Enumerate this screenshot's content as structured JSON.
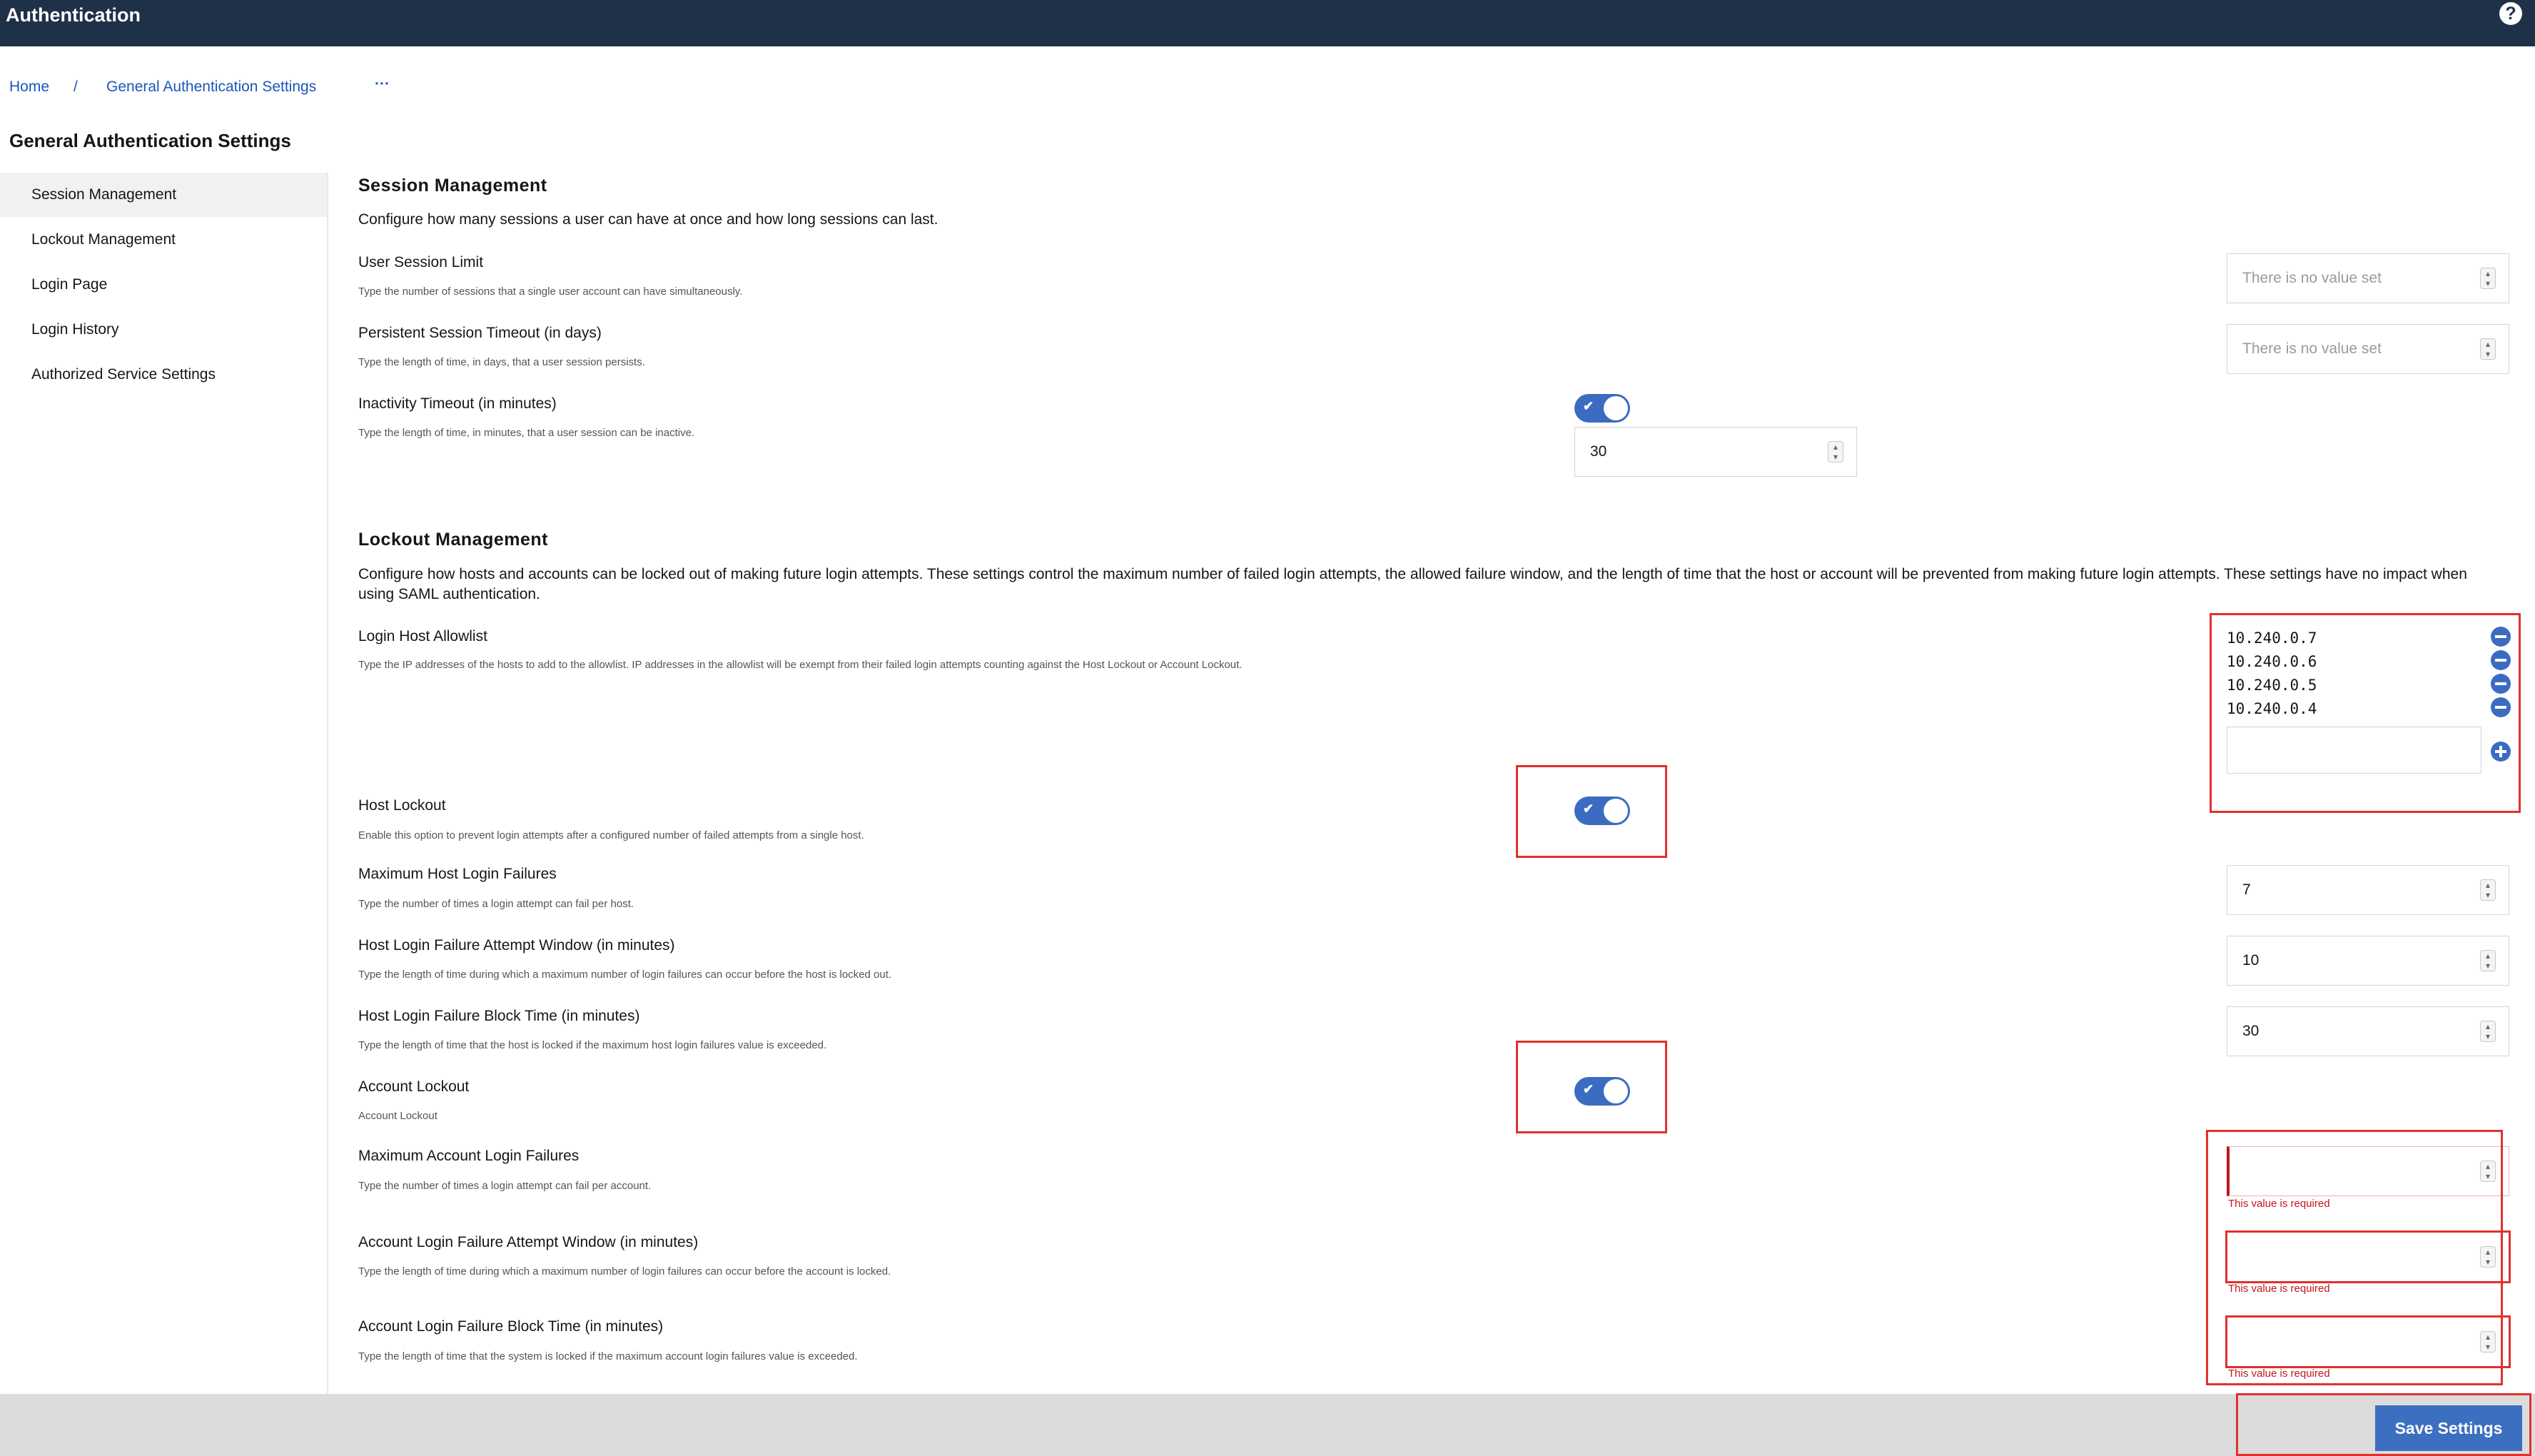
{
  "app": {
    "title": "Authentication",
    "help_icon": "?"
  },
  "breadcrumb": {
    "home": "Home",
    "separator": "/",
    "current": "General Authentication Settings",
    "more": "···"
  },
  "page_title": "General Authentication Settings",
  "sidebar": {
    "items": [
      {
        "label": "Session Management",
        "active": true
      },
      {
        "label": "Lockout Management"
      },
      {
        "label": "Login Page"
      },
      {
        "label": "Login History"
      },
      {
        "label": "Authorized Service Settings"
      }
    ]
  },
  "session": {
    "title": "Session Management",
    "description": "Configure how many sessions a user can have at once and how long sessions can last.",
    "user_session_limit": {
      "label": "User Session Limit",
      "help": "Type the number of sessions that a single user account can have simultaneously.",
      "placeholder": "There is no value set"
    },
    "persistent_timeout": {
      "label": "Persistent Session Timeout (in days)",
      "help": "Type the length of time, in days, that a user session persists.",
      "placeholder": "There is no value set"
    },
    "inactivity_timeout": {
      "label": "Inactivity Timeout (in minutes)",
      "help": "Type the length of time, in minutes, that a user session can be inactive.",
      "enabled": true,
      "value": "30"
    }
  },
  "lockout": {
    "title": "Lockout Management",
    "description": "Configure how hosts and accounts can be locked out of making future login attempts. These settings control the maximum number of failed login attempts, the allowed failure window, and the length of time that the host or account will be prevented from making future login attempts. These settings have no impact when using SAML authentication.",
    "allowlist": {
      "label": "Login Host Allowlist",
      "help": "Type the IP addresses of the hosts to add to the allowlist. IP addresses in the allowlist will be exempt from their failed login attempts counting against the Host Lockout or Account Lockout.",
      "entries": [
        "10.240.0.7",
        "10.240.0.6",
        "10.240.0.5",
        "10.240.0.4"
      ],
      "new_value": ""
    },
    "host_lockout": {
      "label": "Host Lockout",
      "help": "Enable this option to prevent login attempts after a configured number of failed attempts from a single host.",
      "enabled": true
    },
    "max_host_failures": {
      "label": "Maximum Host Login Failures",
      "help": "Type the number of times a login attempt can fail per host.",
      "value": "7"
    },
    "host_window": {
      "label": "Host Login Failure Attempt Window (in minutes)",
      "help": "Type the length of time during which a maximum number of login failures can occur before the host is locked out.",
      "value": "10"
    },
    "host_block": {
      "label": "Host Login Failure Block Time (in minutes)",
      "help": "Type the length of time that the host is locked if the maximum host login failures value is exceeded.",
      "value": "30"
    },
    "account_lockout": {
      "label": "Account Lockout",
      "help": "Account Lockout",
      "enabled": true
    },
    "max_account_failures": {
      "label": "Maximum Account Login Failures",
      "help": "Type the number of times a login attempt can fail per account.",
      "value": "",
      "error": "This value is required"
    },
    "account_window": {
      "label": "Account Login Failure Attempt Window (in minutes)",
      "help": "Type the length of time during which a maximum number of login failures can occur before the account is locked.",
      "value": "",
      "error": "This value is required"
    },
    "account_block": {
      "label": "Account Login Failure Block Time (in minutes)",
      "help": "Type the length of time that the system is locked if the maximum account login failures value is exceeded.",
      "value": "",
      "error": "This value is required"
    }
  },
  "footer": {
    "save_label": "Save Settings"
  },
  "colors": {
    "topbar": "#1f3148",
    "accent": "#3b6cc2",
    "error": "#c2151c",
    "highlight": "#e0312c"
  }
}
